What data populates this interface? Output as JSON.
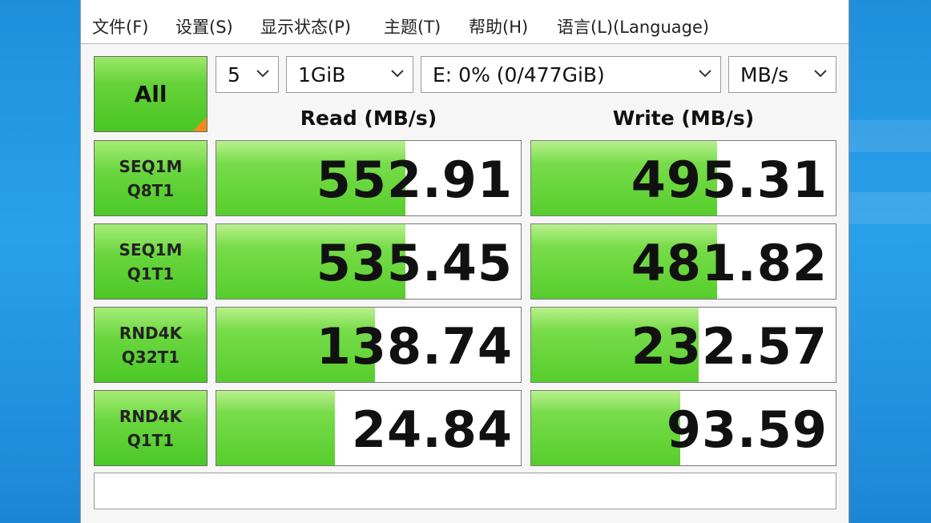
{
  "menu": [
    "文件(F)",
    "设置(S)",
    "显示状态(P)",
    "主题(T)",
    "帮助(H)",
    "语言(L)(Language)"
  ],
  "all_label": "All",
  "dropdowns": {
    "count": "5",
    "size": "1GiB",
    "drive": "E: 0% (0/477GiB)",
    "unit": "MB/s"
  },
  "headers": {
    "read": "Read (MB/s)",
    "write": "Write (MB/s)"
  },
  "tests": [
    {
      "line1": "SEQ1M",
      "line2": "Q8T1",
      "read": "552.91",
      "write": "495.31",
      "read_fill": 0.62,
      "write_fill": 0.61
    },
    {
      "line1": "SEQ1M",
      "line2": "Q1T1",
      "read": "535.45",
      "write": "481.82",
      "read_fill": 0.62,
      "write_fill": 0.61
    },
    {
      "line1": "RND4K",
      "line2": "Q32T1",
      "read": "138.74",
      "write": "232.57",
      "read_fill": 0.52,
      "write_fill": 0.55
    },
    {
      "line1": "RND4K",
      "line2": "Q1T1",
      "read": "24.84",
      "write": "93.59",
      "read_fill": 0.39,
      "write_fill": 0.49
    }
  ],
  "comment": "",
  "colors": {
    "accent_green": "#56ce2c",
    "corner": "#f08a1c",
    "desktop": "#1f8fdc"
  }
}
